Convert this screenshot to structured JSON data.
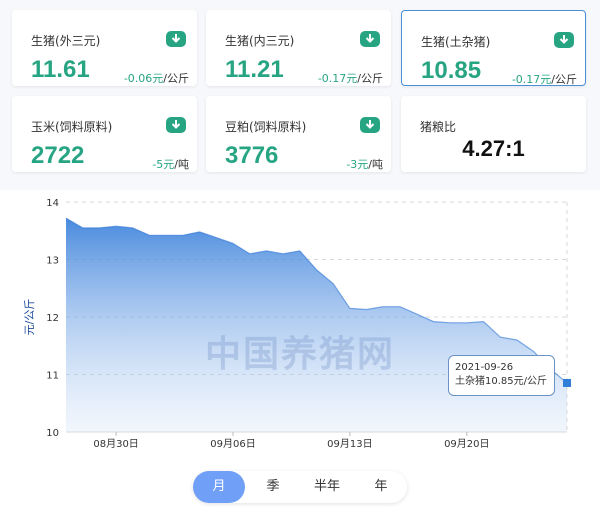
{
  "cards": [
    {
      "title": "生猪(外三元)",
      "value": "11.61",
      "change": "-0.06元",
      "unit": "/公斤"
    },
    {
      "title": "生猪(内三元)",
      "value": "11.21",
      "change": "-0.17元",
      "unit": "/公斤"
    },
    {
      "title": "生猪(土杂猪)",
      "value": "10.85",
      "change": "-0.17元",
      "unit": "/公斤"
    },
    {
      "title": "玉米(饲料原料)",
      "value": "2722",
      "change": "-5元",
      "unit": "/吨"
    },
    {
      "title": "豆粕(饲料原料)",
      "value": "3776",
      "change": "-3元",
      "unit": "/吨"
    }
  ],
  "ratio": {
    "title": "猪粮比",
    "value": "4.27:1"
  },
  "colors": {
    "accent_green": "#27a583",
    "area_top": "#3f84dc",
    "line": "#2e74d6",
    "seg_active": "#6f9ff6"
  },
  "chart_data": {
    "type": "area",
    "title": "",
    "xlabel": "",
    "ylabel": "元/公斤",
    "ylim": [
      10,
      14
    ],
    "yticks": [
      10,
      11,
      12,
      13,
      14
    ],
    "xtick_labels": [
      "08月30日",
      "09月06日",
      "09月13日",
      "09月20日"
    ],
    "xtick_dates": [
      "2021-08-30",
      "2021-09-06",
      "2021-09-13",
      "2021-09-20"
    ],
    "x": [
      "2021-08-27",
      "2021-08-28",
      "2021-08-29",
      "2021-08-30",
      "2021-08-31",
      "2021-09-01",
      "2021-09-02",
      "2021-09-03",
      "2021-09-04",
      "2021-09-05",
      "2021-09-06",
      "2021-09-07",
      "2021-09-08",
      "2021-09-09",
      "2021-09-10",
      "2021-09-11",
      "2021-09-12",
      "2021-09-13",
      "2021-09-14",
      "2021-09-15",
      "2021-09-16",
      "2021-09-17",
      "2021-09-18",
      "2021-09-19",
      "2021-09-20",
      "2021-09-21",
      "2021-09-22",
      "2021-09-23",
      "2021-09-24",
      "2021-09-25",
      "2021-09-26"
    ],
    "series": [
      {
        "values": [
          13.72,
          13.55,
          13.55,
          13.58,
          13.55,
          13.42,
          13.42,
          13.42,
          13.48,
          13.38,
          13.28,
          13.1,
          13.15,
          13.1,
          13.15,
          12.82,
          12.58,
          12.15,
          12.13,
          12.18,
          12.18,
          12.05,
          11.92,
          11.9,
          11.9,
          11.92,
          11.65,
          11.6,
          11.4,
          11.1,
          10.85
        ]
      }
    ],
    "grid": true,
    "tooltip": {
      "date": "2021-09-26",
      "label": "土杂猪10.85元/公斤"
    }
  },
  "watermark": "中国养猪网",
  "period_tabs": [
    "月",
    "季",
    "半年",
    "年"
  ],
  "active_tab": 0
}
